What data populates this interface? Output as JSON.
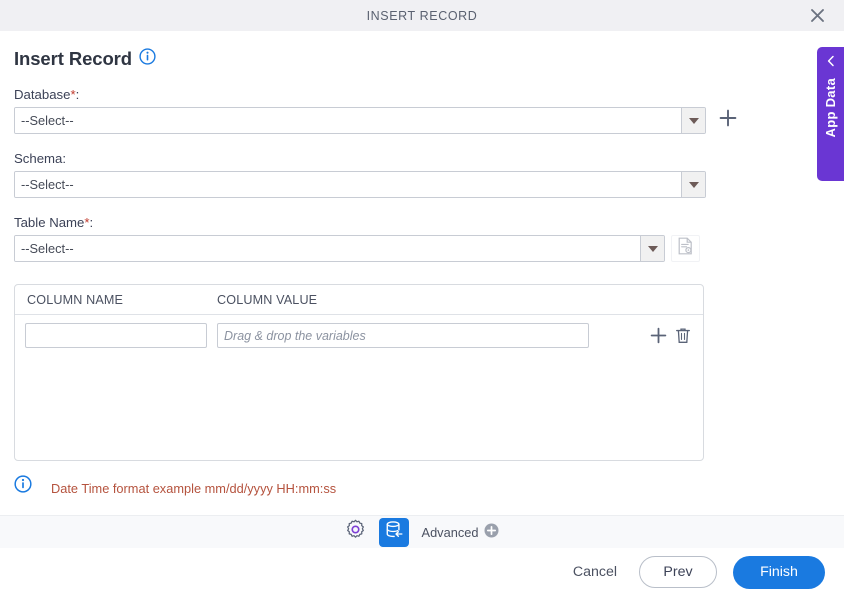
{
  "window": {
    "title": "INSERT RECORD",
    "close_icon": "close-icon"
  },
  "page": {
    "title": "Insert Record",
    "info_icon": "info-circle-icon"
  },
  "form": {
    "database": {
      "label": "Database",
      "required_mark": "*",
      "colon": ":",
      "value": "--Select--",
      "dropdown_icon": "chevron-down-icon",
      "add_icon": "plus-icon"
    },
    "schema": {
      "label": "Schema",
      "required_mark": "",
      "colon": ":",
      "value": "--Select--",
      "dropdown_icon": "chevron-down-icon"
    },
    "table_name": {
      "label": "Table Name",
      "required_mark": "*",
      "colon": ":",
      "value": "--Select--",
      "dropdown_icon": "chevron-down-icon",
      "config_icon": "document-settings-icon"
    }
  },
  "columns_table": {
    "headers": [
      "COLUMN NAME",
      "COLUMN VALUE"
    ],
    "rows": [
      {
        "column_name": "",
        "column_name_placeholder": "",
        "column_value": "",
        "column_value_placeholder": "Drag & drop the variables",
        "add_icon": "plus-icon",
        "delete_icon": "trash-icon"
      }
    ]
  },
  "hint": {
    "icon": "info-circle-icon",
    "text": "Date Time format example mm/dd/yyyy HH:mm:ss",
    "color": "#b5533e"
  },
  "toolbar": {
    "settings_icon": "gear-icon",
    "insert_record_icon": "database-insert-icon",
    "advanced_label": "Advanced",
    "advanced_icon": "plus-circle-icon",
    "active_color": "#1a7ae0"
  },
  "footer": {
    "cancel_label": "Cancel",
    "prev_label": "Prev",
    "finish_label": "Finish",
    "primary_color": "#1a7ae0"
  },
  "app_data_tab": {
    "label": "App Data",
    "chevron_icon": "chevron-left-icon",
    "color": "#6a36d3"
  }
}
